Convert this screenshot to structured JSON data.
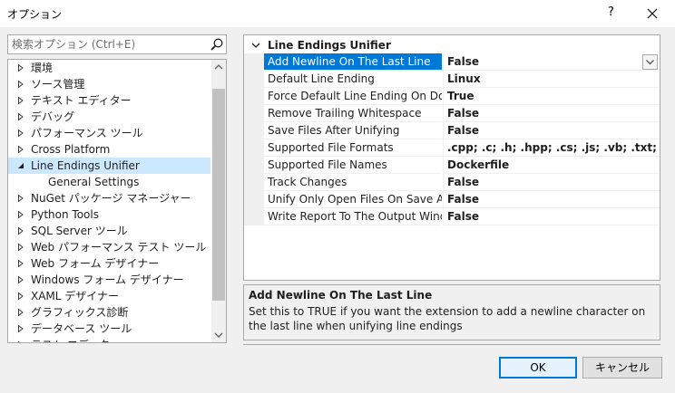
{
  "window": {
    "title": "オプション",
    "help": "?"
  },
  "search": {
    "placeholder": "検索オプション (Ctrl+E)",
    "value": ""
  },
  "tree": {
    "items": [
      {
        "label": "環境",
        "expanded": false
      },
      {
        "label": "ソース管理",
        "expanded": false
      },
      {
        "label": "テキスト エディター",
        "expanded": false
      },
      {
        "label": "デバッグ",
        "expanded": false
      },
      {
        "label": "パフォーマンス ツール",
        "expanded": false
      },
      {
        "label": "Cross Platform",
        "expanded": false
      },
      {
        "label": "Line Endings Unifier",
        "expanded": true,
        "selected": true
      },
      {
        "label": "General Settings",
        "child": true
      },
      {
        "label": "NuGet パッケージ マネージャー",
        "expanded": false
      },
      {
        "label": "Python Tools",
        "expanded": false
      },
      {
        "label": "SQL Server ツール",
        "expanded": false
      },
      {
        "label": "Web パフォーマンス テスト ツール",
        "expanded": false
      },
      {
        "label": "Web フォーム デザイナー",
        "expanded": false
      },
      {
        "label": "Windows フォーム デザイナー",
        "expanded": false
      },
      {
        "label": "XAML デザイナー",
        "expanded": false
      },
      {
        "label": "グラフィックス診断",
        "expanded": false
      },
      {
        "label": "データベース ツール",
        "expanded": false
      },
      {
        "label": "テスト エディター",
        "expanded": false,
        "partial": true
      }
    ]
  },
  "property_grid": {
    "category": "Line Endings Unifier",
    "rows": [
      {
        "name": "Add Newline On The Last Line",
        "value": "False",
        "selected": true
      },
      {
        "name": "Default Line Ending",
        "value": "Linux"
      },
      {
        "name": "Force Default Line Ending On Docum",
        "value": "True"
      },
      {
        "name": "Remove Trailing Whitespace",
        "value": "False"
      },
      {
        "name": "Save Files After Unifying",
        "value": "False"
      },
      {
        "name": "Supported File Formats",
        "value": ".cpp; .c; .h; .hpp; .cs; .js; .vb; .txt; .py"
      },
      {
        "name": "Supported File Names",
        "value": "Dockerfile"
      },
      {
        "name": "Track Changes",
        "value": "False"
      },
      {
        "name": "Unify Only Open Files On Save All",
        "value": "False"
      },
      {
        "name": "Write Report To The Output Window",
        "value": "False"
      }
    ]
  },
  "description": {
    "title": "Add Newline On The Last Line",
    "text": "Set this to TRUE if you want the extension to add a newline character on the last line when unifying line endings"
  },
  "buttons": {
    "ok": "OK",
    "cancel": "キャンセル"
  },
  "colors": {
    "accent": "#0078d7",
    "selection_tree": "#cce8ff"
  }
}
